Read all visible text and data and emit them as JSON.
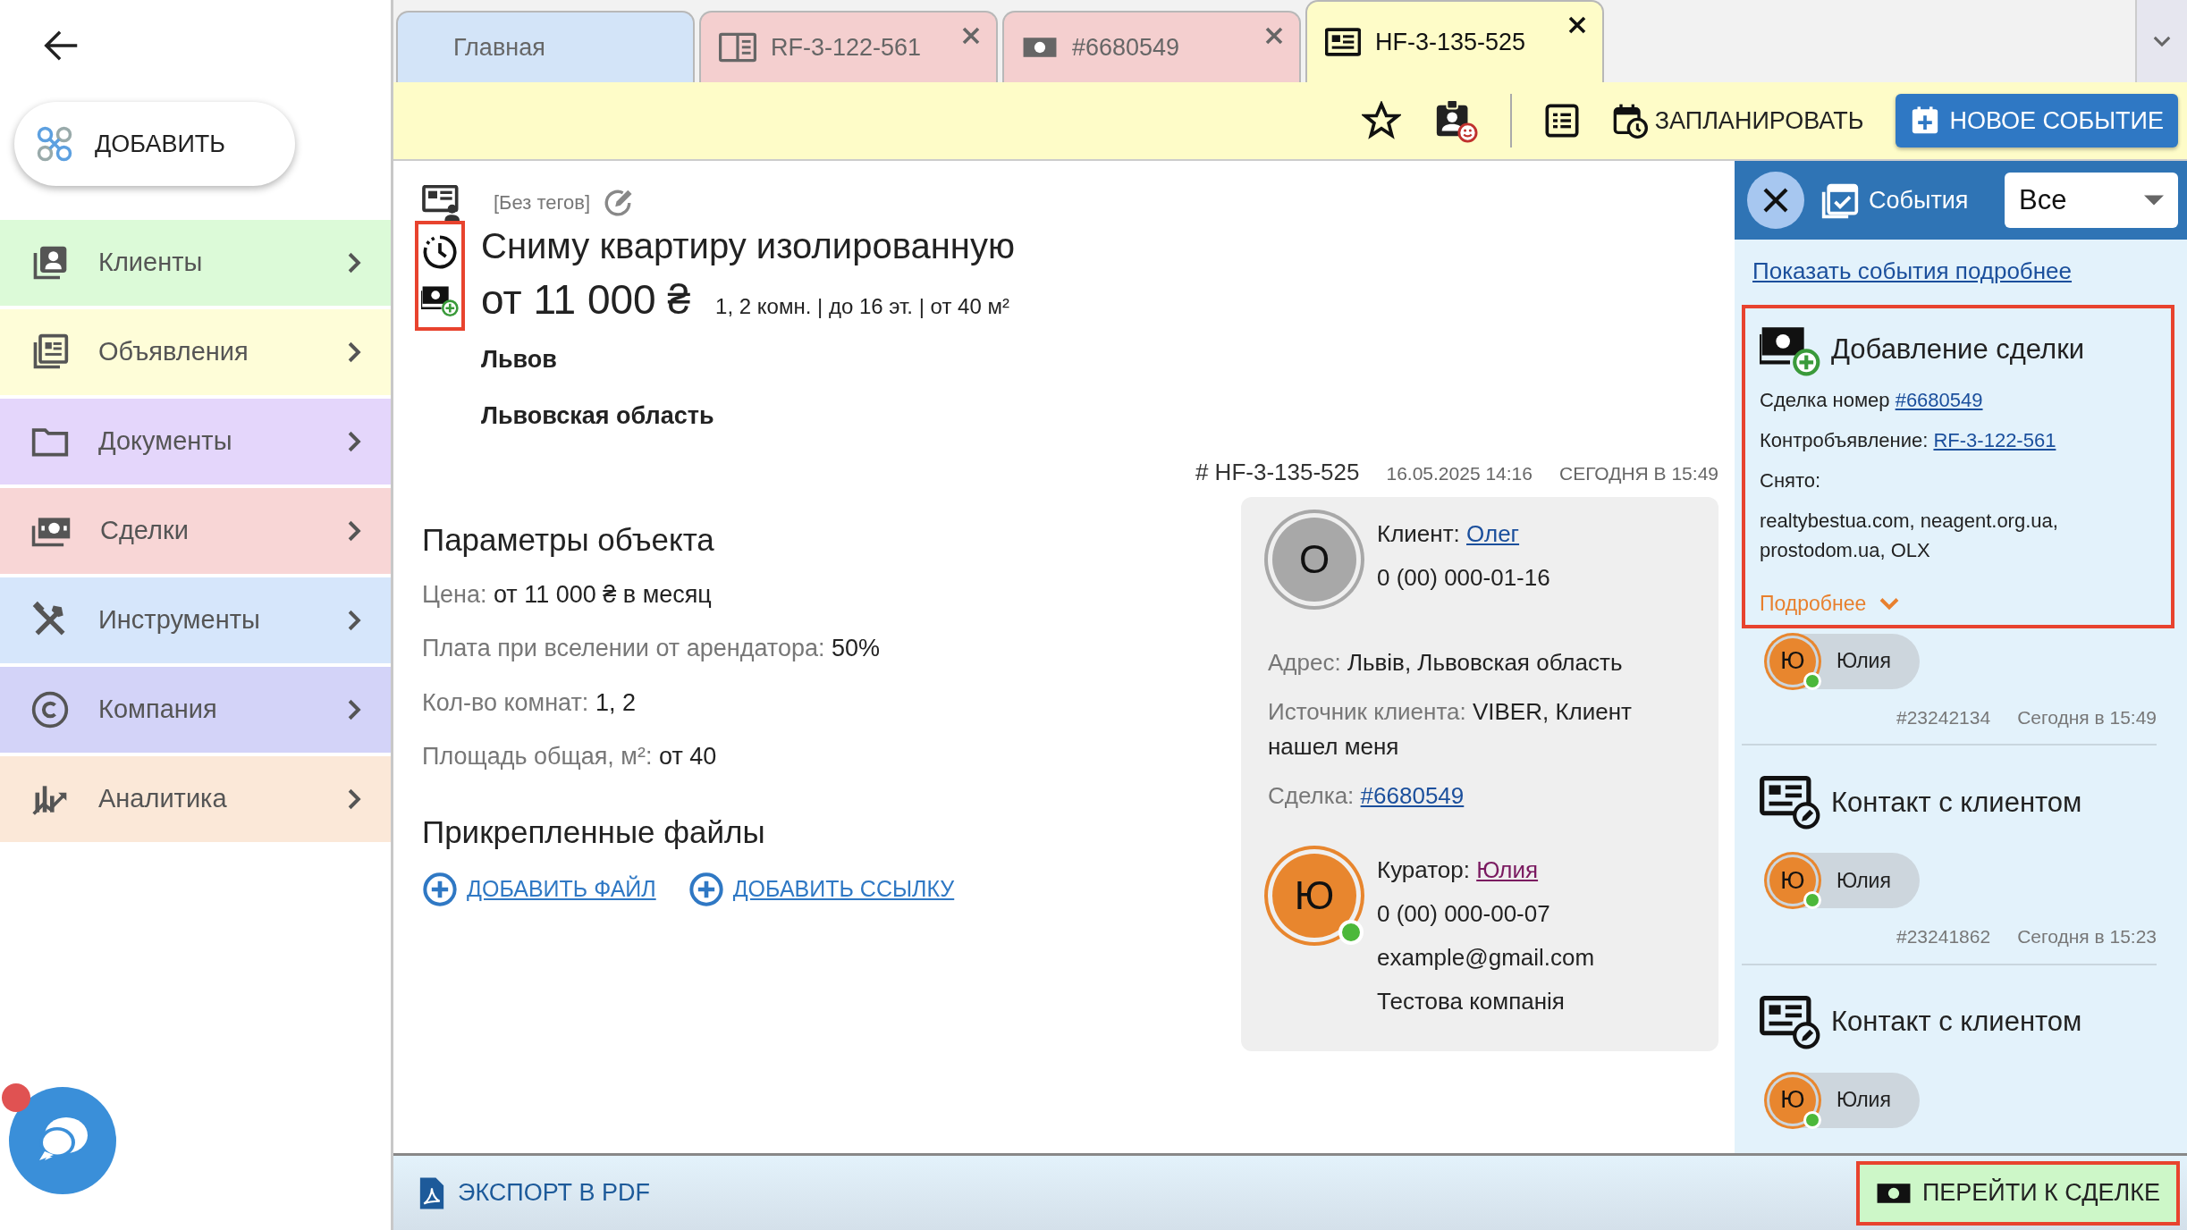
{
  "sidebar": {
    "add_button": "ДОБАВИТЬ",
    "chat_notification": true,
    "items": [
      {
        "label": "Клиенты",
        "color": "#dcfad8"
      },
      {
        "label": "Объявления",
        "color": "#fefdd8"
      },
      {
        "label": "Документы",
        "color": "#e4d6fb"
      },
      {
        "label": "Сделки",
        "color": "#f8d6d6"
      },
      {
        "label": "Инструменты",
        "color": "#d6e6fb"
      },
      {
        "label": "Компания",
        "color": "#d3d3f8"
      },
      {
        "label": "Аналитика",
        "color": "#fbe8d8"
      }
    ]
  },
  "tabs": [
    {
      "label": "Главная",
      "kind": "home",
      "selected": false,
      "closable": false
    },
    {
      "label": "RF-3-122-561",
      "kind": "listing",
      "selected": false,
      "closable": true
    },
    {
      "label": "#6680549",
      "kind": "deal",
      "selected": false,
      "closable": true
    },
    {
      "label": "HF-3-135-525",
      "kind": "request",
      "selected": true,
      "closable": true
    }
  ],
  "toolbar": {
    "schedule": "ЗАПЛАНИРОВАТЬ",
    "new_event": "НОВОЕ СОБЫТИЕ"
  },
  "header": {
    "tags": "[Без тегов]",
    "title": "Сниму квартиру изолированную",
    "price": "от 11 000 ₴",
    "summary": "1, 2 комн. | до 16 эт. | от 40 м²",
    "city": "Львов",
    "region": "Львовская область",
    "icons_highlighted": true,
    "code": "# HF-3-135-525",
    "created": "16.05.2025 14:16",
    "updated": "СЕГОДНЯ В 15:49"
  },
  "params": {
    "title": "Параметры объекта",
    "rows": [
      {
        "label": "Цена:",
        "value": "от 11 000 ₴ в месяц"
      },
      {
        "label": "Плата при вселении от арендатора:",
        "value": "50%"
      },
      {
        "label": "Кол-во комнат:",
        "value": "1, 2"
      },
      {
        "label": "Площадь общая, м²:",
        "value": "от 40"
      }
    ]
  },
  "files": {
    "title": "Прикрепленные файлы",
    "actions": [
      "ДОБАВИТЬ ФАЙЛ",
      "ДОБАВИТЬ ССЫЛКУ"
    ]
  },
  "client_card": {
    "client": {
      "label": "Клиент:",
      "name": "Олег",
      "initial": "О",
      "phone": "0 (00) 000-01-16"
    },
    "fields": [
      {
        "label": "Адрес:",
        "value": "Львів, Львовская область",
        "link": false
      },
      {
        "label": "Источник клиента:",
        "value": "VIBER, Клиент нашел меня",
        "link": false
      },
      {
        "label": "Сделка:",
        "value": "#6680549",
        "link": true
      }
    ],
    "curator": {
      "label": "Куратор:",
      "name": "Юлия",
      "initial": "Ю",
      "online": true,
      "phone": "0 (00) 000-00-07",
      "email": "example@gmail.com",
      "company": "Тестова компанія"
    }
  },
  "events_panel": {
    "title": "События",
    "filter": "Все",
    "show_more": "Показать события подробнее",
    "events": [
      {
        "kind": "deal_added",
        "title": "Добавление сделки",
        "highlighted": true,
        "lines": [
          {
            "text": "Сделка номер",
            "link": "#6680549"
          },
          {
            "text": "Контробъявление:",
            "link": "RF-3-122-561"
          },
          {
            "text": "Снято:"
          },
          {
            "text": "realtybestua.com, neagent.org.ua, prostodom.ua, OLX"
          }
        ],
        "more": "Подробнее",
        "user": {
          "initial": "Ю",
          "name": "Юлия",
          "online": true
        },
        "id": "#23242134",
        "time": "Сегодня в 15:49"
      },
      {
        "kind": "contact",
        "title": "Контакт с клиентом",
        "highlighted": false,
        "user": {
          "initial": "Ю",
          "name": "Юлия",
          "online": true
        },
        "id": "#23241862",
        "time": "Сегодня в 15:23"
      },
      {
        "kind": "contact",
        "title": "Контакт с клиентом",
        "highlighted": false,
        "user": {
          "initial": "Ю",
          "name": "Юлия",
          "online": true
        }
      }
    ]
  },
  "bottom_bar": {
    "export": "ЭКСПОРТ В PDF",
    "goto": "ПЕРЕЙТИ К СДЕЛКЕ",
    "goto_highlighted": true
  }
}
